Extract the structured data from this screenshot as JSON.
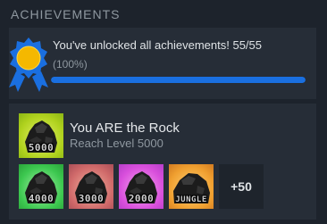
{
  "section": {
    "title": "ACHIEVEMENTS"
  },
  "summary": {
    "message": "You've unlocked all achievements! 55/55",
    "percent_label": "(100%)",
    "progress_fraction": 1.0
  },
  "featured": {
    "title": "You ARE the Rock",
    "description": "Reach Level 5000",
    "badge_text": "5000"
  },
  "others": [
    {
      "badge_text": "4000"
    },
    {
      "badge_text": "3000"
    },
    {
      "badge_text": "2000"
    },
    {
      "badge_text": "JUNGLE"
    }
  ],
  "more_label": "+50",
  "colors": {
    "background": "#1d232c",
    "panel": "#262d37",
    "progress": "#1a6fe0",
    "medal": "#1a6fe0",
    "medal_center": "#f5b800"
  }
}
